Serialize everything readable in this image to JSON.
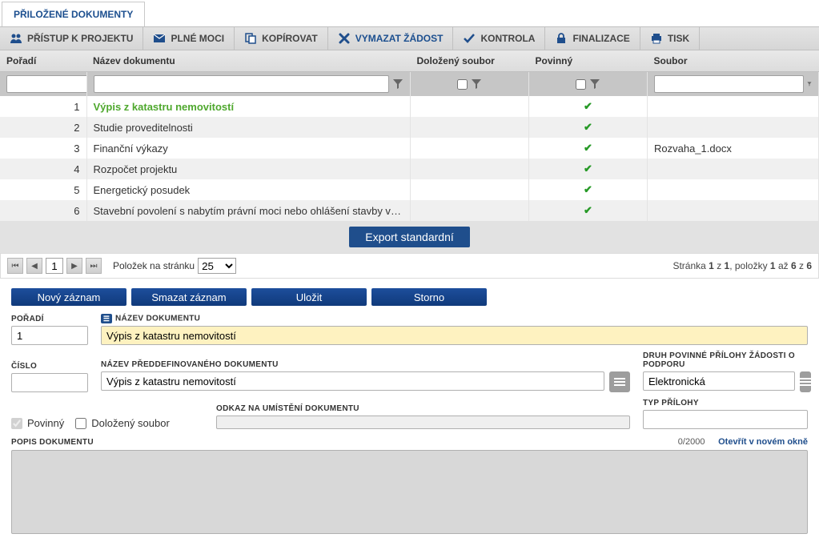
{
  "tab_title": "PŘILOŽENÉ DOKUMENTY",
  "toolbar": {
    "access": "PŘÍSTUP K PROJEKTU",
    "poa": "PLNÉ MOCI",
    "copy": "KOPÍROVAT",
    "delete": "VYMAZAT ŽÁDOST",
    "check": "KONTROLA",
    "finalize": "FINALIZACE",
    "print": "TISK"
  },
  "grid": {
    "headers": {
      "order": "Pořadí",
      "name": "Název dokumentu",
      "uploaded": "Doložený soubor",
      "mandatory": "Povinný",
      "file": "Soubor"
    },
    "rows": [
      {
        "order": "1",
        "name": "Výpis z katastru nemovitostí",
        "uploaded": "",
        "mandatory": true,
        "file": "",
        "active": true
      },
      {
        "order": "2",
        "name": "Studie proveditelnosti",
        "uploaded": "",
        "mandatory": true,
        "file": ""
      },
      {
        "order": "3",
        "name": "Finanční výkazy",
        "uploaded": "",
        "mandatory": true,
        "file": "Rozvaha_1.docx"
      },
      {
        "order": "4",
        "name": "Rozpočet projektu",
        "uploaded": "",
        "mandatory": true,
        "file": ""
      },
      {
        "order": "5",
        "name": "Energetický posudek",
        "uploaded": "",
        "mandatory": true,
        "file": ""
      },
      {
        "order": "6",
        "name": "Stavební povolení s nabytím právní moci nebo ohlášení stavby včetně...",
        "uploaded": "",
        "mandatory": true,
        "file": ""
      }
    ],
    "export_label": "Export standardní",
    "pager": {
      "items_label": "Položek na stránku",
      "page": "1",
      "page_size": "25",
      "summary_prefix": "Stránka ",
      "summary_page": "1",
      "summary_of": " z ",
      "summary_pages": "1",
      "summary_items": ", položky ",
      "summary_from": "1",
      "summary_to_word": " až ",
      "summary_to": "6",
      "summary_total_word": " z ",
      "summary_total": "6"
    }
  },
  "buttons": {
    "new": "Nový záznam",
    "delete": "Smazat záznam",
    "save": "Uložit",
    "cancel": "Storno"
  },
  "form": {
    "labels": {
      "order": "POŘADÍ",
      "name": "NÁZEV DOKUMENTU",
      "number": "ČÍSLO",
      "predefined": "NÁZEV PŘEDDEFINOVANÉHO DOKUMENTU",
      "kind": "DRUH POVINNÉ PŘÍLOHY ŽÁDOSTI O PODPORU",
      "mandatory": "Povinný",
      "uploaded": "Doložený soubor",
      "link": "ODKAZ NA UMÍSTĚNÍ DOKUMENTU",
      "attachment_type": "TYP PŘÍLOHY",
      "description": "POPIS DOKUMENTU"
    },
    "values": {
      "order": "1",
      "name": "Výpis z katastru nemovitostí",
      "number": "",
      "predefined": "Výpis z katastru nemovitostí",
      "kind": "Elektronická",
      "mandatory": true,
      "uploaded": false,
      "link": "",
      "attachment_type": "",
      "description": ""
    },
    "counter": "0/2000",
    "open_new": "Otevřít v novém okně"
  }
}
